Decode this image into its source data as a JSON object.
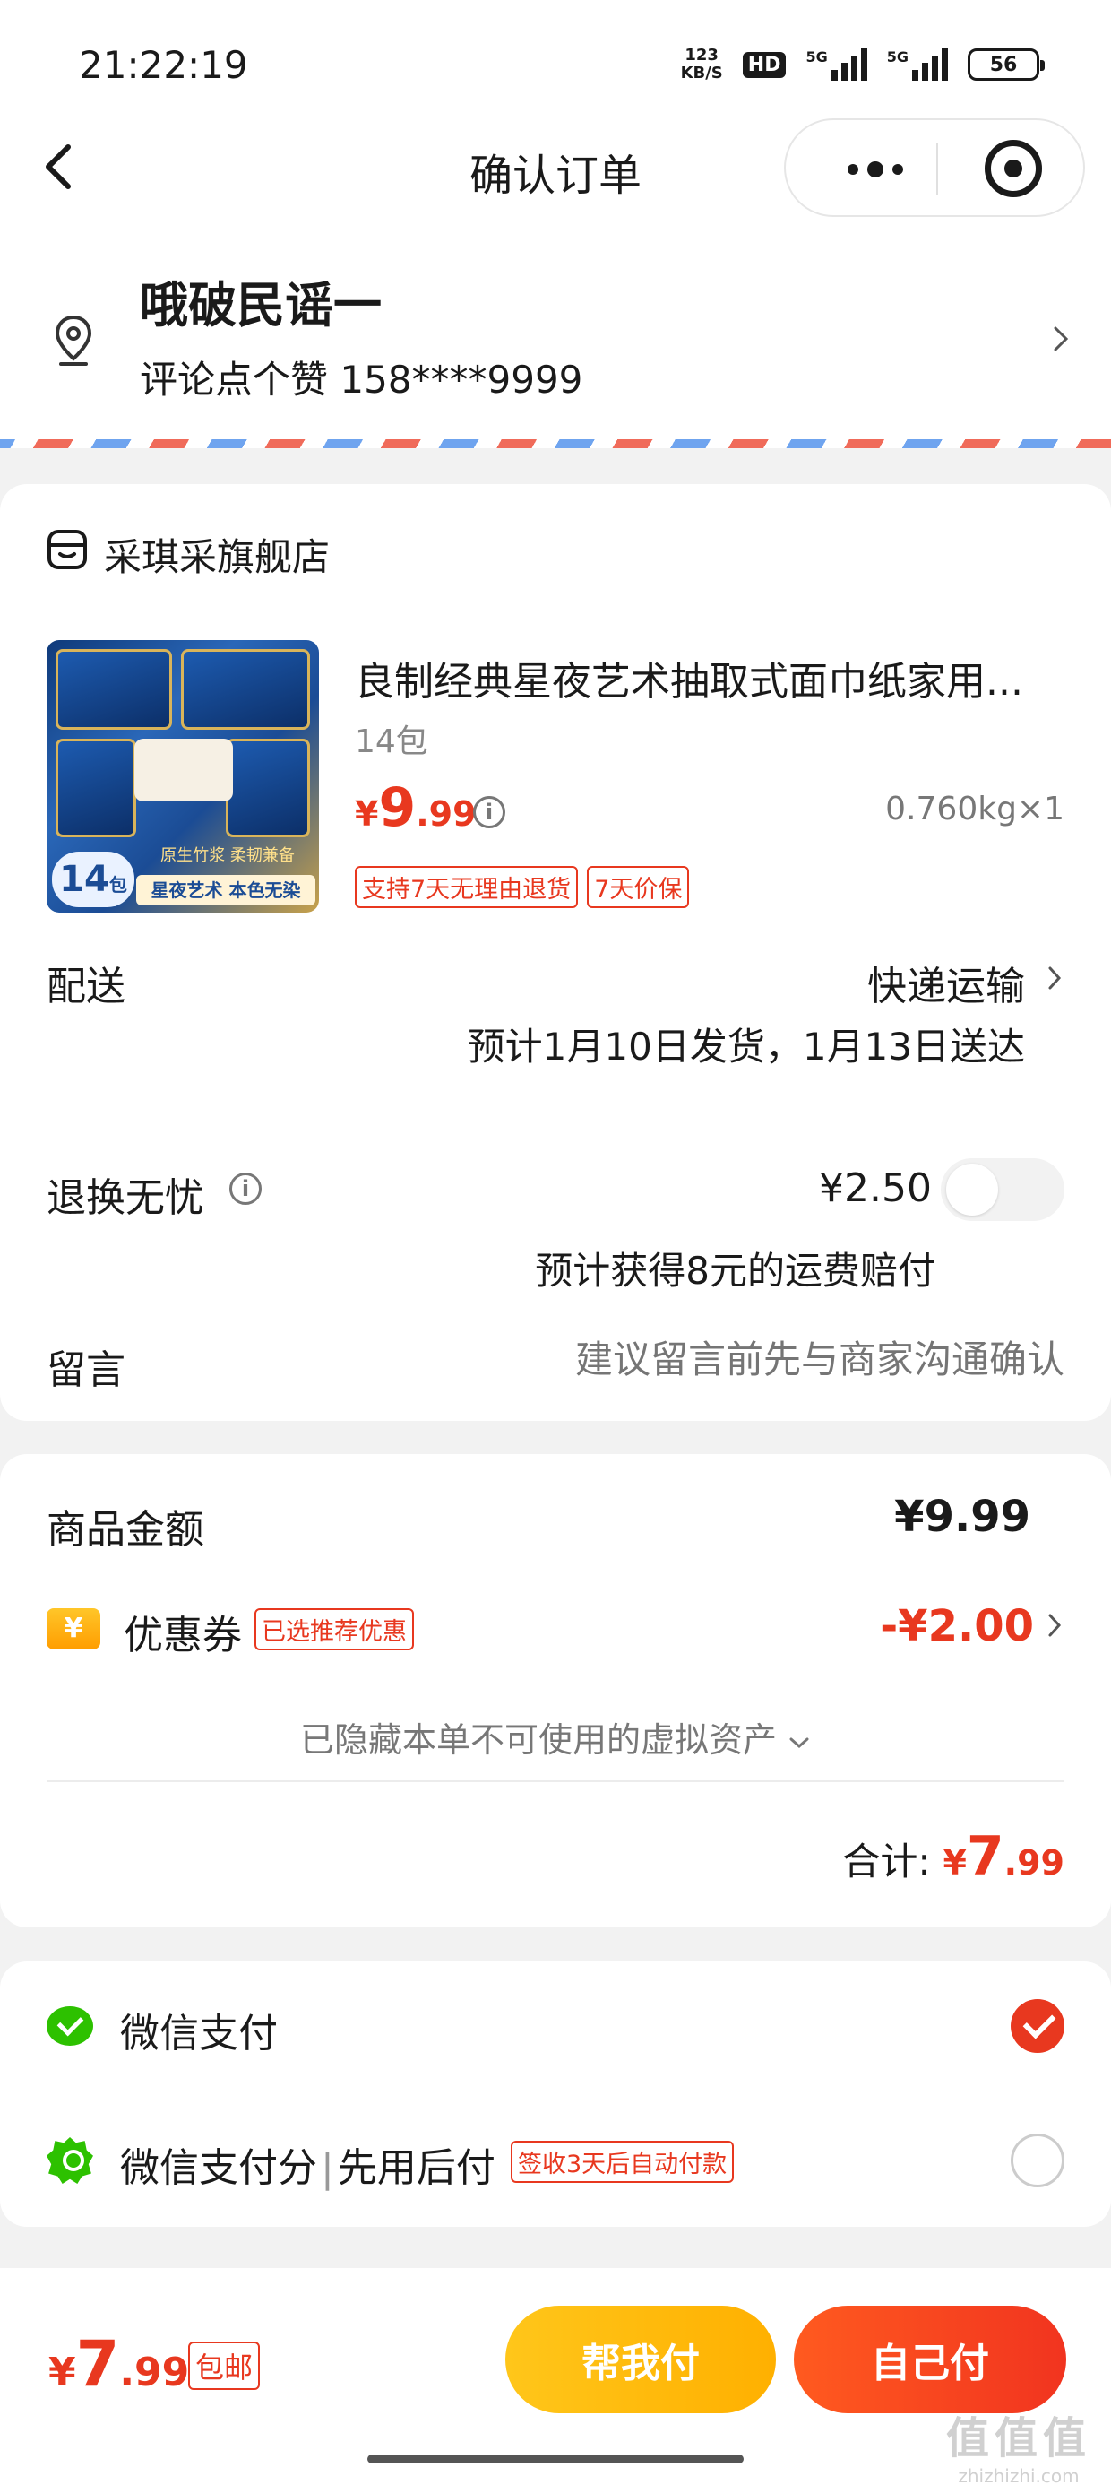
{
  "status_bar": {
    "time": "21:22:19",
    "speed_value": "123",
    "speed_unit": "KB/S",
    "hd": "HD",
    "net1": "5G",
    "net2": "5G",
    "battery": "56"
  },
  "nav": {
    "title": "确认订单",
    "back_icon": "chevron-left-icon",
    "more_icon": "more-dots-icon",
    "close_icon": "target-close-icon"
  },
  "address": {
    "name": "哦破民谣一",
    "contact": "评论点个赞 158****9999",
    "icon": "location-pin-icon"
  },
  "shop": {
    "name": "采琪采旗舰店",
    "icon": "shop-icon"
  },
  "product": {
    "title": "良制经典星夜艺术抽取式面巾纸家用...",
    "spec": "14包",
    "price_symbol": "¥",
    "price_int": "9",
    "price_dec": ".99",
    "weight_qty": "0.760kg×1",
    "tags": [
      "支持7天无理由退货",
      "7天价保"
    ],
    "image": {
      "count": "14",
      "count_unit": "包",
      "band_top": "原生竹浆 柔韧兼备",
      "band_bottom": "星夜艺术 本色无染"
    }
  },
  "delivery": {
    "label": "配送",
    "method": "快递运输",
    "eta": "预计1月10日发货，1月13日送达"
  },
  "return_service": {
    "label": "退换无忧",
    "price": "¥2.50",
    "note": "预计获得8元的运费赔付",
    "enabled": false
  },
  "message": {
    "label": "留言",
    "placeholder": "建议留言前先与商家沟通确认"
  },
  "amounts": {
    "goods_label": "商品金额",
    "goods_value": "¥9.99",
    "coupon_icon_text": "¥",
    "coupon_label": "优惠券",
    "coupon_tag": "已选推荐优惠",
    "coupon_value": "-¥2.00",
    "hidden_assets": "已隐藏本单不可使用的虚拟资产",
    "total_label": "合计:",
    "total_symbol": "¥",
    "total_int": "7",
    "total_dec": ".99"
  },
  "payment": {
    "wechat_pay": "微信支付",
    "wechat_score": "微信支付分",
    "score_sep": "|",
    "score_mode": "先用后付",
    "score_tag": "签收3天后自动付款",
    "selected": "wechat_pay"
  },
  "bottom": {
    "price_symbol": "¥",
    "price_int": "7",
    "price_dec": ".99",
    "free_shipping": "包邮",
    "help_pay": "帮我付",
    "self_pay": "自己付"
  },
  "watermark": {
    "big": "值值值",
    "small": "zhizhizhi.com"
  },
  "colors": {
    "accent_red": "#e8381f",
    "help_yellow": "#ffb000",
    "wechat_green": "#2dc100"
  }
}
